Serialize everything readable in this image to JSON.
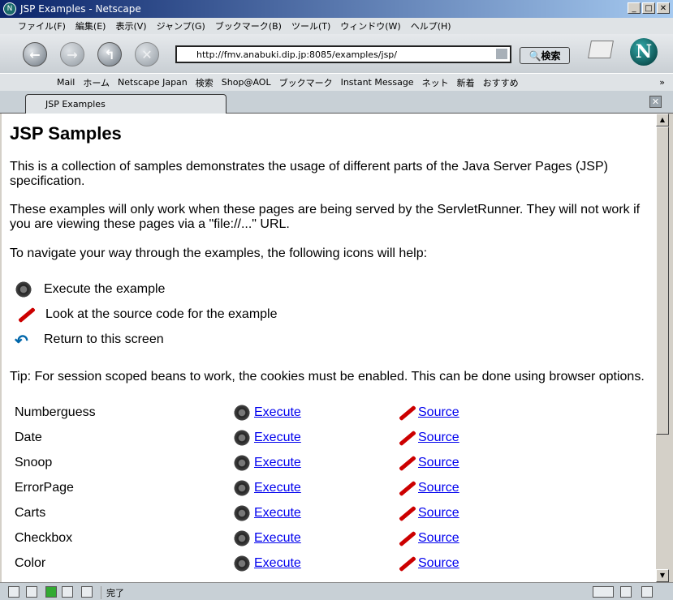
{
  "window": {
    "title": "JSP Examples - Netscape"
  },
  "menu": [
    "ファイル(F)",
    "編集(E)",
    "表示(V)",
    "ジャンプ(G)",
    "ブックマーク(B)",
    "ツール(T)",
    "ウィンドウ(W)",
    "ヘルプ(H)"
  ],
  "nav": {
    "url": "http://fmv.anabuki.dip.jp:8085/examples/jsp/",
    "search_label": "検索"
  },
  "personal_toolbar": [
    "Mail",
    "ホーム",
    "Netscape Japan",
    "検索",
    "Shop@AOL",
    "ブックマーク",
    "Instant Message",
    "ネット",
    "新着",
    "おすすめ"
  ],
  "tab": {
    "label": "JSP Examples"
  },
  "page": {
    "title": "JSP Samples",
    "intro": "This is a collection of samples demonstrates the usage of different parts of the Java Server Pages (JSP) specification.",
    "note": "These examples will only work when these pages are being served by the ServletRunner. They will not work if you are viewing these pages via a \"file://...\" URL.",
    "navigate": "To navigate your way through the examples, the following icons will help:",
    "legend": [
      {
        "icon": "execute-gears-icon",
        "text": "Execute the example"
      },
      {
        "icon": "source-pen-icon",
        "text": "Look at the source code for the example"
      },
      {
        "icon": "return-icon",
        "text": "Return to this screen"
      }
    ],
    "tip": "Tip: For session scoped beans to work, the cookies must be enabled. This can be done using browser options.",
    "execute_label": "Execute",
    "source_label": "Source",
    "examples": [
      "Numberguess",
      "Date",
      "Snoop",
      "ErrorPage",
      "Carts",
      "Checkbox",
      "Color"
    ]
  },
  "status": {
    "text": "完了"
  }
}
